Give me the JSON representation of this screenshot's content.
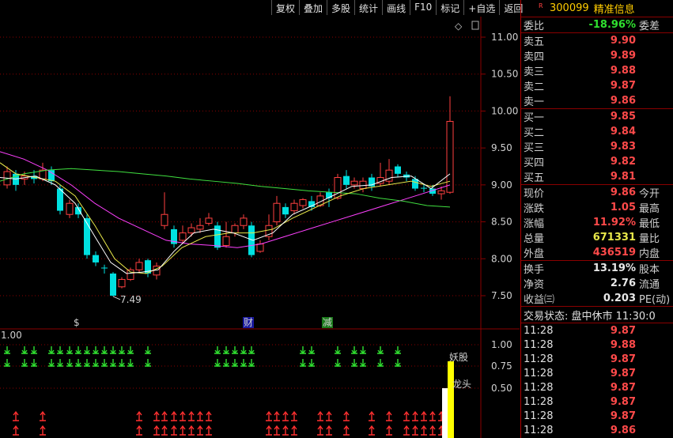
{
  "toolbar": {
    "buttons": [
      "复权",
      "叠加",
      "多股",
      "统计",
      "画线",
      "F10",
      "标记",
      "+自选",
      "返回"
    ]
  },
  "chart": {
    "price_axis": [
      "11.00",
      "10.50",
      "10.00",
      "9.50",
      "9.00",
      "8.50",
      "8.00",
      "7.50"
    ],
    "low_label": "7.49",
    "indicator_axis": [
      "1.00",
      "0.75",
      "0.50"
    ],
    "indicator_top_label": "1.00",
    "markers": {
      "s": "$",
      "cai": "财",
      "jian": "减"
    },
    "annotations": {
      "yaogu": "妖股",
      "longtou": "龙头"
    },
    "diamond": "◇",
    "colors": {
      "up": "#ff4040",
      "down": "#00e0e0",
      "ma5": "#ffffff",
      "ma10": "#e8e84a",
      "ma20": "#ff40ff",
      "ma60": "#40e040",
      "grid": "#8a0000"
    }
  },
  "stock": {
    "tag": "R",
    "code": "300099",
    "name": "精准信息",
    "weibi_label": "委比",
    "weibi_value": "-18.96%",
    "weicha_label": "委差"
  },
  "asks": [
    {
      "label": "卖五",
      "price": "9.90"
    },
    {
      "label": "卖四",
      "price": "9.89"
    },
    {
      "label": "卖三",
      "price": "9.88"
    },
    {
      "label": "卖二",
      "price": "9.87"
    },
    {
      "label": "卖一",
      "price": "9.86"
    }
  ],
  "bids": [
    {
      "label": "买一",
      "price": "9.85"
    },
    {
      "label": "买二",
      "price": "9.84"
    },
    {
      "label": "买三",
      "price": "9.83"
    },
    {
      "label": "买四",
      "price": "9.82"
    },
    {
      "label": "买五",
      "price": "9.81"
    }
  ],
  "quote": [
    {
      "label": "现价",
      "value": "9.86",
      "color": "red",
      "label2": "今开"
    },
    {
      "label": "涨跌",
      "value": "1.05",
      "color": "red",
      "label2": "最高"
    },
    {
      "label": "涨幅",
      "value": "11.92%",
      "color": "red",
      "label2": "最低"
    },
    {
      "label": "总量",
      "value": "671331",
      "color": "yellow",
      "label2": "量比"
    },
    {
      "label": "外盘",
      "value": "436519",
      "color": "red",
      "label2": "内盘"
    }
  ],
  "fundamentals": [
    {
      "label": "换手",
      "value": "13.19%",
      "label2": "股本"
    },
    {
      "label": "净资",
      "value": "2.76",
      "label2": "流通"
    },
    {
      "label": "收益㈢",
      "value": "0.203",
      "label2": "PE(动)"
    }
  ],
  "status": {
    "text": "交易状态: 盘中休市 11:30:0"
  },
  "ticks": [
    {
      "time": "11:28",
      "price": "9.87"
    },
    {
      "time": "11:28",
      "price": "9.88"
    },
    {
      "time": "11:28",
      "price": "9.87"
    },
    {
      "time": "11:28",
      "price": "9.87"
    },
    {
      "time": "11:28",
      "price": "9.87"
    },
    {
      "time": "11:28",
      "price": "9.87"
    },
    {
      "time": "11:28",
      "price": "9.87"
    },
    {
      "time": "11:28",
      "price": "9.86"
    }
  ]
}
